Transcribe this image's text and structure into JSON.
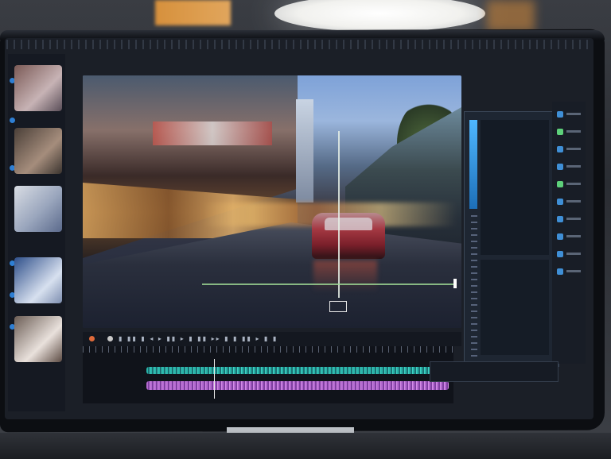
{
  "scene": {
    "description_icons": [
      "ceiling-lamp",
      "monitor",
      "video-frame",
      "audio-waveform"
    ],
    "accent_colors": {
      "timeline_teal": "#29b3a8",
      "timeline_purple": "#b46ad0",
      "selection_blue": "#2e7fd4",
      "playback_orange": "#e06a3a"
    }
  },
  "editor": {
    "control_strip": "▮ ▮▮ ▮ ◂ ▸ ▮▮ ▸ ▮ ▮▮ ▸▸ ▮ ▮ ▮▮ ▸ ▮ ▮"
  }
}
